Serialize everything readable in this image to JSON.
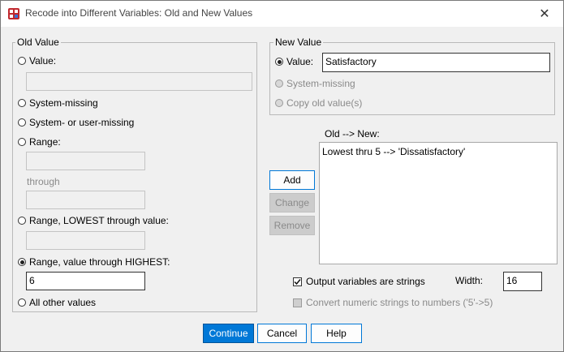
{
  "window": {
    "title": "Recode into Different Variables: Old and New Values",
    "close_glyph": "✕"
  },
  "old_value": {
    "group_label": "Old Value",
    "value_label": "Value:",
    "value_input": "",
    "system_missing_label": "System-missing",
    "system_or_user_missing_label": "System- or user-missing",
    "range_label": "Range:",
    "range_from": "",
    "through_label": "through",
    "range_to": "",
    "range_lowest_label": "Range, LOWEST through value:",
    "range_lowest_input": "",
    "range_highest_label": "Range, value through HIGHEST:",
    "range_highest_input": "6",
    "all_other_label": "All other values",
    "selected": "range_highest"
  },
  "new_value": {
    "group_label": "New Value",
    "value_label": "Value:",
    "value_input": "Satisfactory",
    "system_missing_label": "System-missing",
    "copy_old_label": "Copy old value(s)",
    "selected": "value"
  },
  "mapping": {
    "label": "Old --> New:",
    "items": [
      "Lowest thru 5 --> 'Dissatisfactory'"
    ]
  },
  "buttons": {
    "add": "Add",
    "change": "Change",
    "remove": "Remove",
    "continue": "Continue",
    "cancel": "Cancel",
    "help": "Help"
  },
  "options": {
    "output_strings_label": "Output variables are strings",
    "output_strings_checked": true,
    "width_label": "Width:",
    "width_value": "16",
    "convert_label": "Convert numeric strings to numbers ('5'->5)",
    "convert_checked": false
  },
  "colors": {
    "accent": "#0078d7",
    "disabled_bg": "#cccccc",
    "window_bg": "#f0f0f0"
  }
}
